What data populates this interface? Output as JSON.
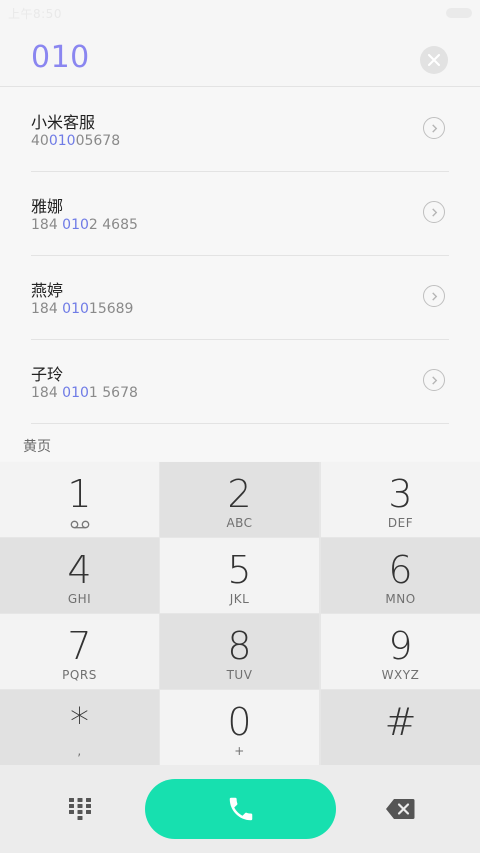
{
  "status": {
    "time": "上午8:50"
  },
  "dial": {
    "number": "010"
  },
  "results": [
    {
      "name": "小米客服",
      "phone_pre": "40",
      "phone_hl": "010",
      "phone_post": "05678"
    },
    {
      "name": "雅娜",
      "phone_pre": "184 ",
      "phone_hl": "010",
      "phone_post": "2 4685"
    },
    {
      "name": "燕婷",
      "phone_pre": "184 ",
      "phone_hl": "010",
      "phone_post": "15689"
    },
    {
      "name": "子玲",
      "phone_pre": "184 ",
      "phone_hl": "010",
      "phone_post": "1 5678"
    }
  ],
  "section_label": "黄页",
  "keypad": [
    {
      "digit": "1",
      "letters": ""
    },
    {
      "digit": "2",
      "letters": "ABC"
    },
    {
      "digit": "3",
      "letters": "DEF"
    },
    {
      "digit": "4",
      "letters": "GHI"
    },
    {
      "digit": "5",
      "letters": "JKL"
    },
    {
      "digit": "6",
      "letters": "MNO"
    },
    {
      "digit": "7",
      "letters": "PQRS"
    },
    {
      "digit": "8",
      "letters": "TUV"
    },
    {
      "digit": "9",
      "letters": "WXYZ"
    },
    {
      "digit": "*",
      "letters": ","
    },
    {
      "digit": "0",
      "letters": "+"
    },
    {
      "digit": "#",
      "letters": ""
    }
  ],
  "colors": {
    "accent": "#17e0af",
    "highlight": "#6f7be6",
    "dial_number": "#8a86f0"
  },
  "icons": {
    "clear": "close-icon",
    "chevron": "chevron-right-icon",
    "voicemail": "voicemail-icon",
    "dialpad": "dialpad-icon",
    "call": "phone-icon",
    "backspace": "backspace-icon"
  }
}
